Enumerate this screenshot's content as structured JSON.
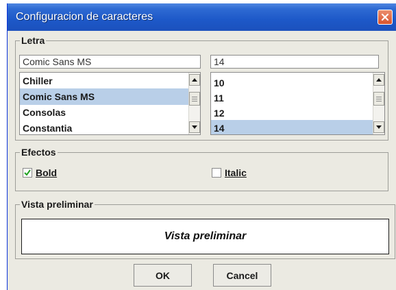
{
  "window": {
    "title": "Configuracion de caracteres"
  },
  "letra": {
    "label": "Letra",
    "font_field": "Comic Sans MS",
    "size_field": "14",
    "fonts": [
      {
        "label": "Chiller",
        "selected": false
      },
      {
        "label": "Comic Sans MS",
        "selected": true
      },
      {
        "label": "Consolas",
        "selected": false
      },
      {
        "label": "Constantia",
        "selected": false
      }
    ],
    "sizes": [
      {
        "label": "10",
        "selected": false
      },
      {
        "label": "11",
        "selected": false
      },
      {
        "label": "12",
        "selected": false
      },
      {
        "label": "14",
        "selected": true
      }
    ]
  },
  "efectos": {
    "label": "Efectos",
    "bold": {
      "label": "Bold",
      "checked": true
    },
    "italic": {
      "label": "Italic",
      "checked": false
    }
  },
  "preview": {
    "label": "Vista preliminar",
    "text": "Vista preliminar"
  },
  "buttons": {
    "ok": "OK",
    "cancel": "Cancel"
  }
}
